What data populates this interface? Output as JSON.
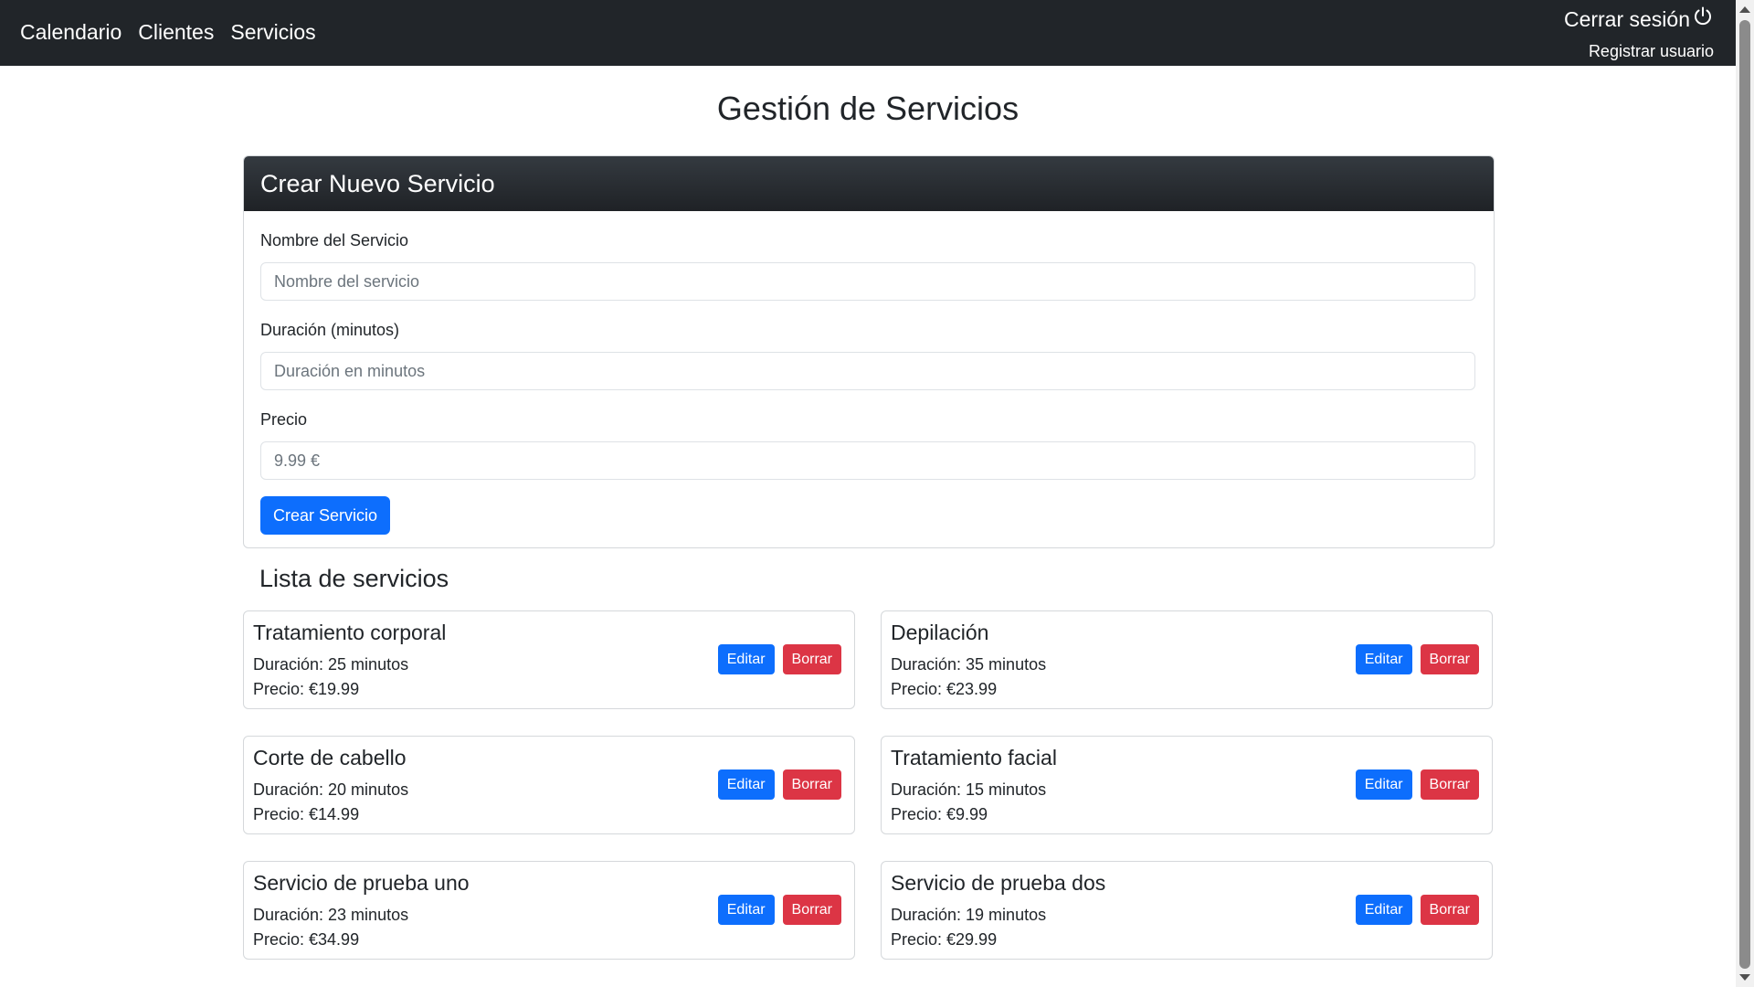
{
  "navbar": {
    "links": [
      "Calendario",
      "Clientes",
      "Servicios"
    ],
    "logout_label": "Cerrar sesión",
    "register_label": "Registrar usuario"
  },
  "page_title": "Gestión de Servicios",
  "create_form": {
    "header": "Crear Nuevo Servicio",
    "name_label": "Nombre del Servicio",
    "name_placeholder": "Nombre del servicio",
    "duration_label": "Duración (minutos)",
    "duration_placeholder": "Duración en minutos",
    "price_label": "Precio",
    "price_placeholder": "9.99 €",
    "submit_label": "Crear Servicio"
  },
  "list_title": "Lista de servicios",
  "button_labels": {
    "edit": "Editar",
    "delete": "Borrar"
  },
  "services": [
    {
      "name": "Tratamiento corporal",
      "duration": "Duración: 25 minutos",
      "price": "Precio: €19.99"
    },
    {
      "name": "Depilación",
      "duration": "Duración: 35 minutos",
      "price": "Precio: €23.99"
    },
    {
      "name": "Corte de cabello",
      "duration": "Duración: 20 minutos",
      "price": "Precio: €14.99"
    },
    {
      "name": "Tratamiento facial",
      "duration": "Duración: 15 minutos",
      "price": "Precio: €9.99"
    },
    {
      "name": "Servicio de prueba uno",
      "duration": "Duración: 23 minutos",
      "price": "Precio: €34.99"
    },
    {
      "name": "Servicio de prueba dos",
      "duration": "Duración: 19 minutos",
      "price": "Precio: €29.99"
    }
  ],
  "colors": {
    "navbar": "#212529",
    "primary": "#0d6efd",
    "danger": "#dc3545"
  },
  "icons": {
    "logout": "power-icon"
  }
}
